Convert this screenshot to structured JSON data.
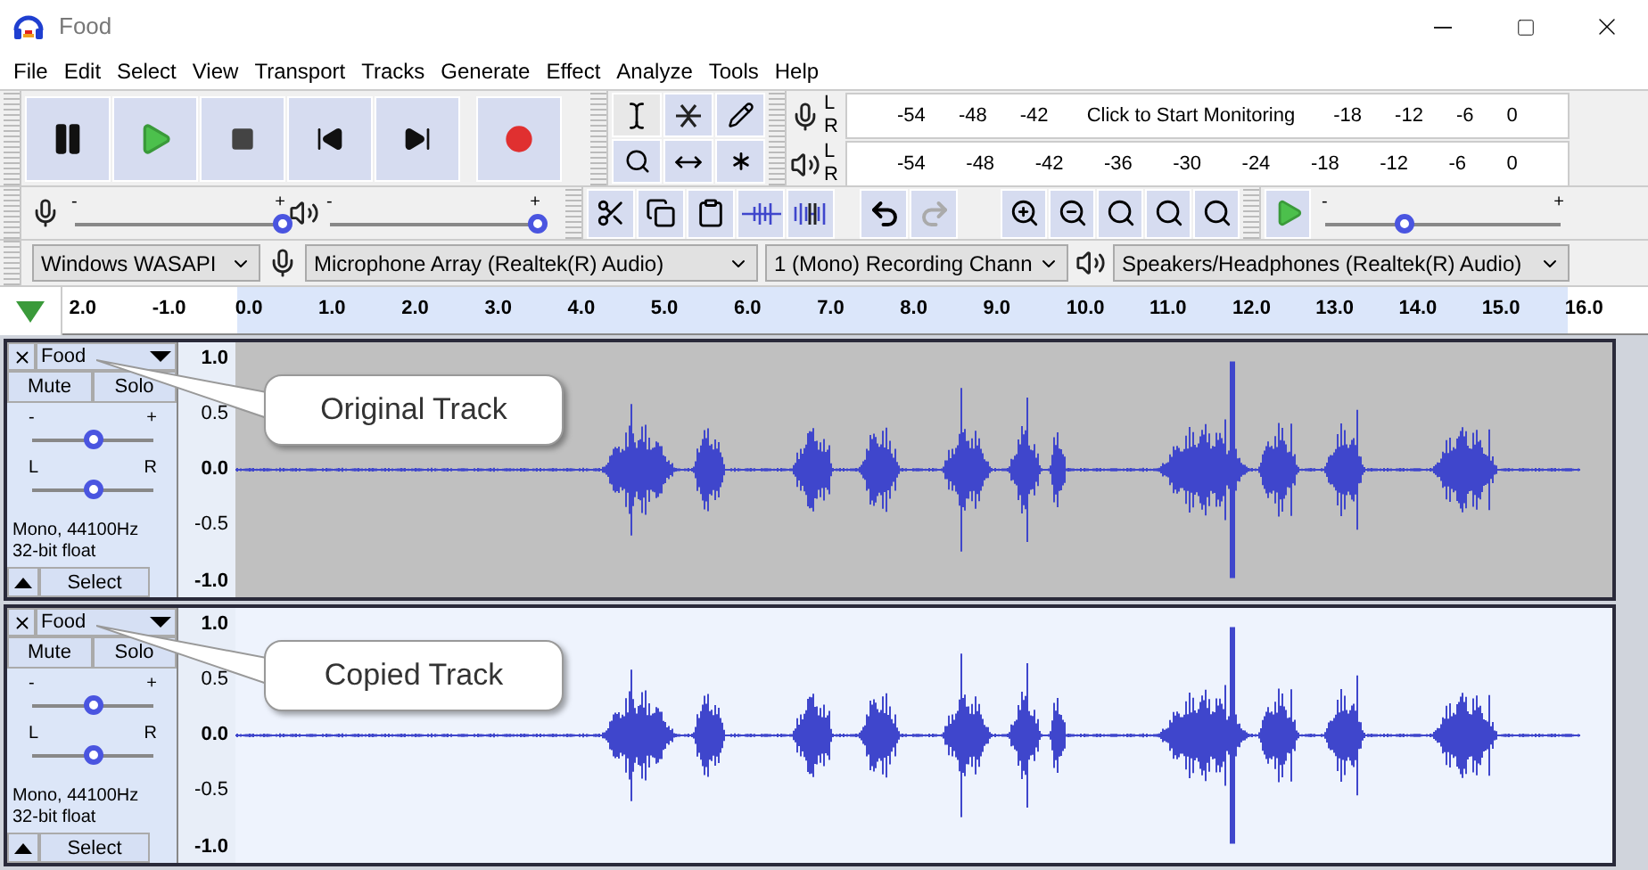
{
  "window": {
    "title": "Food"
  },
  "menu": [
    "File",
    "Edit",
    "Select",
    "View",
    "Transport",
    "Tracks",
    "Generate",
    "Effect",
    "Analyze",
    "Tools",
    "Help"
  ],
  "meters": [
    {
      "kind": "recording",
      "channels": [
        "L",
        "R"
      ],
      "labels": [
        {
          "kind": "tick",
          "text": "-54"
        },
        {
          "kind": "tick",
          "text": "-48"
        },
        {
          "kind": "tick",
          "text": "-42"
        },
        {
          "kind": "message",
          "text": "Click to Start Monitoring"
        },
        {
          "kind": "tick",
          "text": "-18"
        },
        {
          "kind": "tick",
          "text": "-12"
        },
        {
          "kind": "tick",
          "text": "-6"
        },
        {
          "kind": "tick",
          "text": "0"
        }
      ]
    },
    {
      "kind": "playback",
      "channels": [
        "L",
        "R"
      ],
      "labels": [
        {
          "kind": "tick",
          "text": "-54"
        },
        {
          "kind": "tick",
          "text": "-48"
        },
        {
          "kind": "tick",
          "text": "-42"
        },
        {
          "kind": "tick",
          "text": "-36"
        },
        {
          "kind": "tick",
          "text": "-30"
        },
        {
          "kind": "tick",
          "text": "-24"
        },
        {
          "kind": "tick",
          "text": "-18"
        },
        {
          "kind": "tick",
          "text": "-12"
        },
        {
          "kind": "tick",
          "text": "-6"
        },
        {
          "kind": "tick",
          "text": "0"
        }
      ]
    }
  ],
  "mixer": {
    "recording": {
      "min": "-",
      "max": "+",
      "level": 1
    },
    "playback": {
      "min": "-",
      "max": "+",
      "level": 1
    }
  },
  "play_at_speed": {
    "min": "-",
    "max": "+",
    "level": 0.33
  },
  "devices": {
    "host": "Windows WASAPI",
    "recording_device": "Microphone Array (Realtek(R) Audio)",
    "channels": "1 (Mono) Recording Chann",
    "playback_device": "Speakers/Headphones (Realtek(R) Audio)"
  },
  "ruler": [
    "2.0",
    "-1.0",
    "0.0",
    "1.0",
    "2.0",
    "3.0",
    "4.0",
    "5.0",
    "6.0",
    "7.0",
    "8.0",
    "9.0",
    "10.0",
    "11.0",
    "12.0",
    "13.0",
    "14.0",
    "15.0",
    "16.0"
  ],
  "tracks": [
    {
      "name": "Food",
      "selected": false,
      "mute": "Mute",
      "solo": "Solo",
      "gain": {
        "min": "-",
        "max": "+",
        "level": 0.5
      },
      "pan": {
        "min": "L",
        "max": "R",
        "level": 0.5
      },
      "info": [
        "Mono, 44100Hz",
        "32-bit float"
      ],
      "select": "Select",
      "scale": [
        "1.0",
        "0.5",
        "0.0",
        "-0.5",
        "-1.0"
      ],
      "callout": "Original Track"
    },
    {
      "name": "Food",
      "selected": true,
      "mute": "Mute",
      "solo": "Solo",
      "gain": {
        "min": "-",
        "max": "+",
        "level": 0.5
      },
      "pan": {
        "min": "L",
        "max": "R",
        "level": 0.5
      },
      "info": [
        "Mono, 44100Hz",
        "32-bit float"
      ],
      "select": "Select",
      "scale": [
        "1.0",
        "0.5",
        "0.0",
        "-0.5",
        "-1.0"
      ],
      "callout": "Copied Track"
    }
  ]
}
